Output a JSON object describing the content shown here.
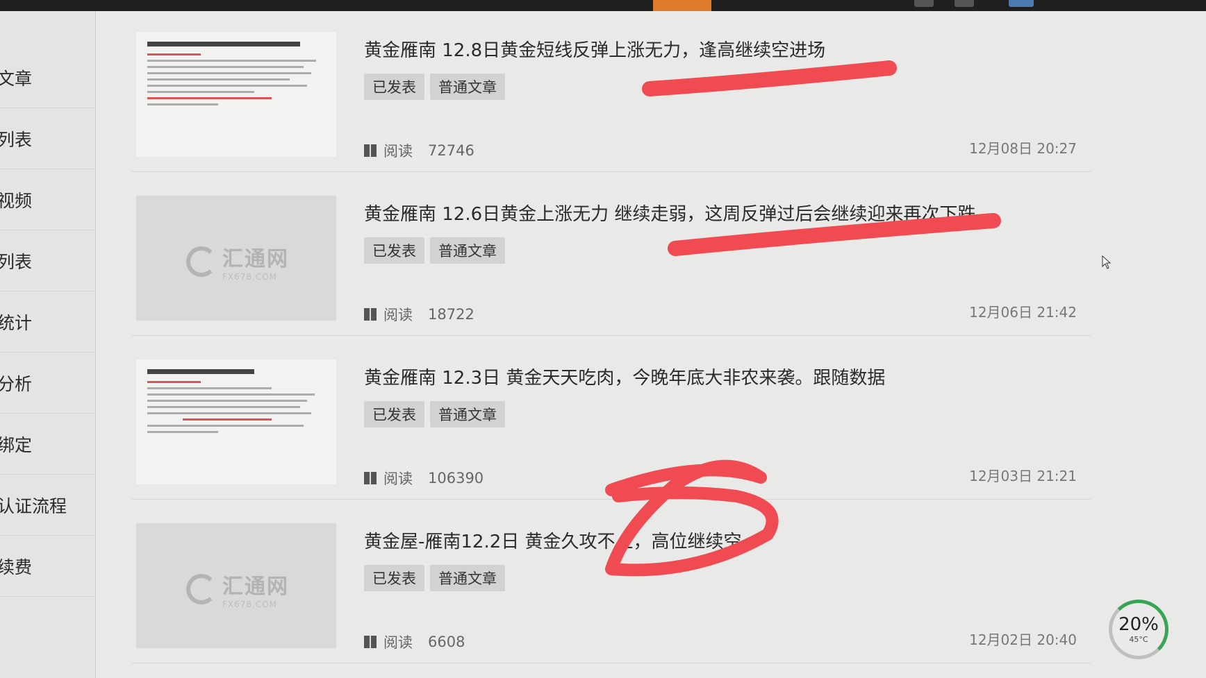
{
  "sidebar": {
    "items": [
      {
        "label": "文章"
      },
      {
        "label": "列表"
      },
      {
        "label": "视频"
      },
      {
        "label": "列表"
      },
      {
        "label": "统计"
      },
      {
        "label": "分析"
      },
      {
        "label": "绑定"
      },
      {
        "label": "认证流程"
      },
      {
        "label": "续费"
      }
    ]
  },
  "articles": [
    {
      "title": "黄金雁南 12.8日黄金短线反弹上涨无力，逢高继续空进场",
      "status": "已发表",
      "type": "普通文章",
      "read_label": "阅读",
      "views": "72746",
      "date": "12月08日 20:27",
      "thumb": "document"
    },
    {
      "title": "黄金雁南 12.6日黄金上涨无力 继续走弱，这周反弹过后会继续迎来再次下跌",
      "status": "已发表",
      "type": "普通文章",
      "read_label": "阅读",
      "views": "18722",
      "date": "12月06日 21:42",
      "thumb": "logo"
    },
    {
      "title": "黄金雁南 12.3日 黄金天天吃肉，今晚年底大非农来袭。跟随数据",
      "status": "已发表",
      "type": "普通文章",
      "read_label": "阅读",
      "views": "106390",
      "date": "12月03日 21:21",
      "thumb": "document"
    },
    {
      "title": "黄金屋-雁南12.2日 黄金久攻不上，高位继续空",
      "status": "已发表",
      "type": "普通文章",
      "read_label": "阅读",
      "views": "6608",
      "date": "12月02日 20:40",
      "thumb": "logo"
    }
  ],
  "logo": {
    "name": "汇通网",
    "domain": "FX678.COM"
  },
  "widget": {
    "percent": "20%",
    "temp": "45°C"
  },
  "colors": {
    "scribble": "#f04a52",
    "accent": "#e07a2c",
    "ring": "#3aa456"
  }
}
